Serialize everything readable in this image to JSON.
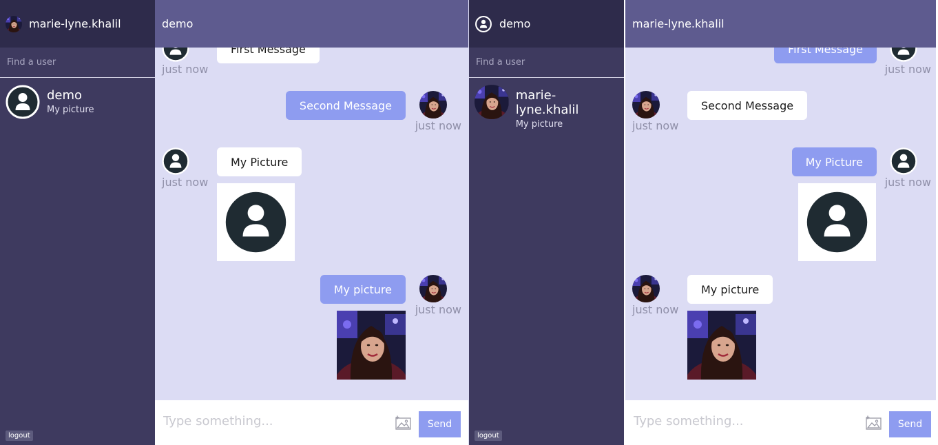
{
  "colors": {
    "sidebar": "#3e3a5f",
    "sidebar_header": "#2e2b4b",
    "chat_header": "#5e5b8f",
    "chat_bg": "#dcdcf4",
    "outgoing_bubble": "#8e9cf0",
    "incoming_bubble": "#ffffff"
  },
  "left": {
    "me": {
      "name": "marie-lyne.khalil"
    },
    "search": {
      "placeholder": "Find a user"
    },
    "contact": {
      "name": "demo",
      "subtitle": "My picture",
      "icon": "default-user-icon"
    },
    "chat": {
      "title": "demo",
      "messages": [
        {
          "from": "demo",
          "text": "First Message",
          "time": "just now"
        },
        {
          "from": "me",
          "text": "Second Message",
          "time": "just now"
        },
        {
          "from": "demo",
          "text": "My Picture",
          "time": "just now",
          "image": "default-user-icon"
        },
        {
          "from": "me",
          "text": "My picture",
          "time": "just now",
          "image": "profile-photo"
        }
      ]
    },
    "composer": {
      "placeholder": "Type something...",
      "send_label": "Send",
      "icon": "image-upload-icon"
    },
    "logout_label": "logout"
  },
  "right": {
    "me": {
      "name": "demo"
    },
    "search": {
      "placeholder": "Find a user"
    },
    "contact": {
      "name": "marie-lyne.khalil",
      "subtitle": "My picture",
      "icon": "profile-photo"
    },
    "chat": {
      "title": "marie-lyne.khalil",
      "messages": [
        {
          "from": "me",
          "text": "First Message",
          "time": "just now"
        },
        {
          "from": "marie-lyne.khalil",
          "text": "Second Message",
          "time": "just now"
        },
        {
          "from": "me",
          "text": "My Picture",
          "time": "just now",
          "image": "default-user-icon"
        },
        {
          "from": "marie-lyne.khalil",
          "text": "My picture",
          "time": "just now",
          "image": "profile-photo"
        }
      ]
    },
    "composer": {
      "placeholder": "Type something...",
      "send_label": "Send",
      "icon": "image-upload-icon"
    },
    "logout_label": "logout"
  }
}
